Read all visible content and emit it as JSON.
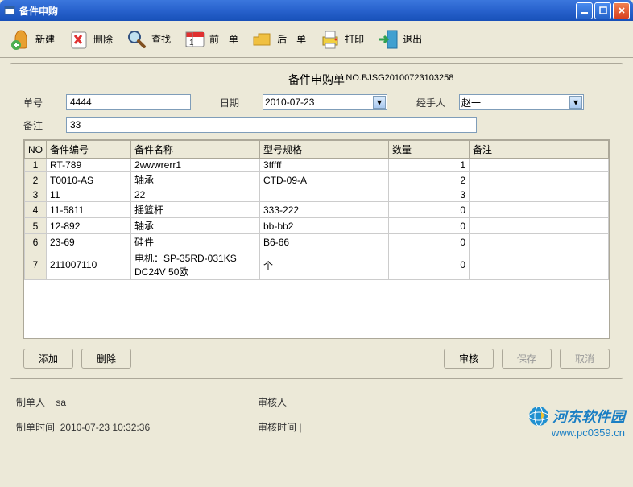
{
  "window": {
    "title": "备件申购"
  },
  "toolbar": {
    "new": "新建",
    "delete": "删除",
    "find": "查找",
    "prev": "前一单",
    "next": "后一单",
    "print": "打印",
    "exit": "退出"
  },
  "form": {
    "title": "备件申购单",
    "order_no": "NO.BJSG20100723103258",
    "label_id": "单号",
    "id": "4444",
    "label_date": "日期",
    "date": "2010-07-23",
    "label_handler": "经手人",
    "handler": "赵一",
    "label_remark": "备注",
    "remark": "33"
  },
  "table": {
    "headers": {
      "no": "NO",
      "code": "备件编号",
      "name": "备件名称",
      "spec": "型号规格",
      "qty": "数量",
      "remark": "备注"
    },
    "rows": [
      {
        "no": "1",
        "code": "RT-789",
        "name": "2wwwrerr1",
        "spec": "3fffff",
        "qty": "1",
        "remark": ""
      },
      {
        "no": "2",
        "code": "T0010-AS",
        "name": "轴承",
        "spec": "CTD-09-A",
        "qty": "2",
        "remark": ""
      },
      {
        "no": "3",
        "code": "11",
        "name": "22",
        "spec": "",
        "qty": "3",
        "remark": ""
      },
      {
        "no": "4",
        "code": "11-5811",
        "name": "摇篮杆",
        "spec": "333-222",
        "qty": "0",
        "remark": ""
      },
      {
        "no": "5",
        "code": "12-892",
        "name": "轴承",
        "spec": "bb-bb2",
        "qty": "0",
        "remark": ""
      },
      {
        "no": "6",
        "code": "23-69",
        "name": "硅件",
        "spec": "B6-66",
        "qty": "0",
        "remark": ""
      },
      {
        "no": "7",
        "code": "211007110",
        "name": "电机：SP-35RD-031KS DC24V  50欧",
        "spec": "个",
        "qty": "0",
        "remark": ""
      }
    ]
  },
  "buttons": {
    "add": "添加",
    "delete": "删除",
    "audit": "审核",
    "save": "保存",
    "cancel": "取消"
  },
  "footer": {
    "maker_label": "制单人",
    "maker": "sa",
    "auditor_label": "审核人",
    "auditor": "",
    "make_time_label": "制单时间",
    "make_time": "2010-07-23 10:32:36",
    "audit_time_label": "审核时间",
    "audit_time": ""
  },
  "watermark": {
    "name": "河东软件园",
    "url": "www.pc0359.cn"
  }
}
